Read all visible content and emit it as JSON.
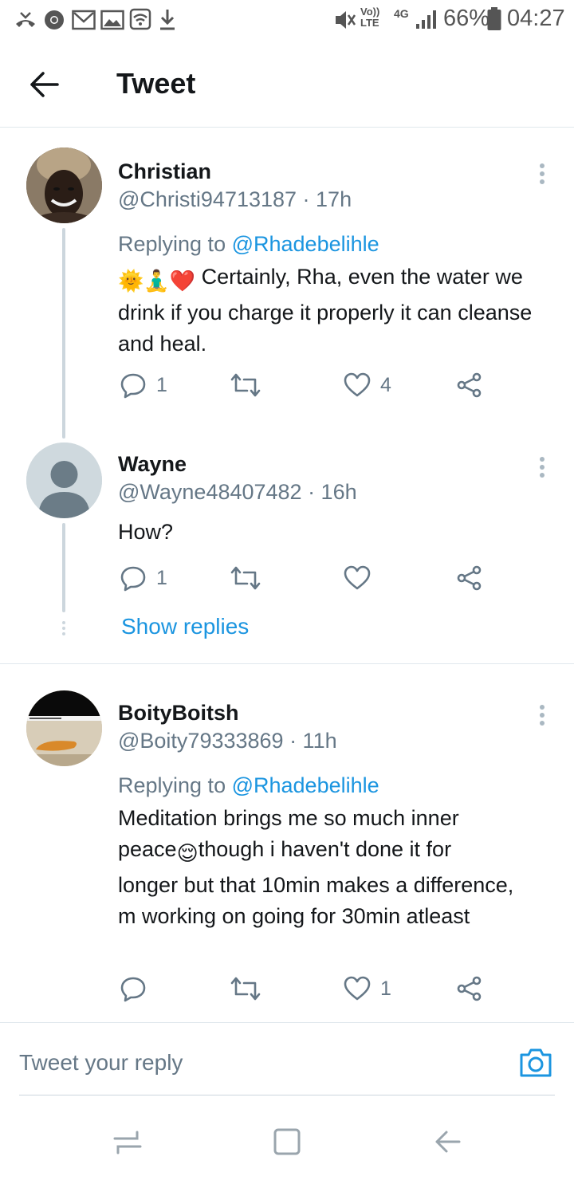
{
  "status_bar": {
    "battery": "66%",
    "time": "04:27",
    "volte": "Vo))",
    "lte": "LTE",
    "network": "4G"
  },
  "header": {
    "title": "Tweet",
    "back_icon": "arrow-left-icon"
  },
  "tweets": [
    {
      "name": "Christian",
      "handle": "@Christi94713187 · 17h",
      "replying_prefix": "Replying to ",
      "replying_to": "@Rhadebelihle",
      "emoji_text": "🌞🧘‍♂️❤️",
      "text": "Certainly, Rha, even the water we drink if you charge it properly it can cleanse and heal.",
      "reply_count": "1",
      "retweet_count": "",
      "like_count": "4"
    },
    {
      "name": "Wayne",
      "handle": "@Wayne48407482 · 16h",
      "text": "How?",
      "reply_count": "1",
      "retweet_count": "",
      "like_count": ""
    },
    {
      "name": "BoityBoitsh",
      "handle": "@Boity79333869 · 11h",
      "replying_prefix": "Replying to ",
      "replying_to": "@Rhadebelihle",
      "text_part1": "Meditation brings me so much inner peace",
      "text_emoji": "😌",
      "text_part2": "though i haven't done it for longer but that 10min makes a difference, m working on going for 30min atleast",
      "reply_count": "",
      "retweet_count": "",
      "like_count": "1"
    }
  ],
  "show_replies": "Show replies",
  "reply_bar": {
    "placeholder": "Tweet your reply"
  },
  "colors": {
    "accent": "#1b95e0",
    "secondary_text": "#657786",
    "divider": "#e1e8ed"
  }
}
